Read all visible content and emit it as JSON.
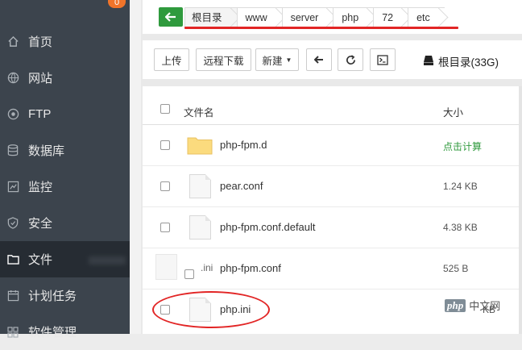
{
  "sidebar": {
    "badge": "0",
    "items": [
      {
        "label": "首页",
        "icon": "home-icon"
      },
      {
        "label": "网站",
        "icon": "globe-icon"
      },
      {
        "label": "FTP",
        "icon": "ftp-icon"
      },
      {
        "label": "数据库",
        "icon": "database-icon"
      },
      {
        "label": "监控",
        "icon": "monitor-icon"
      },
      {
        "label": "安全",
        "icon": "shield-icon"
      },
      {
        "label": "文件",
        "icon": "folder-icon"
      },
      {
        "label": "计划任务",
        "icon": "calendar-icon"
      },
      {
        "label": "软件管理",
        "icon": "apps-icon"
      }
    ],
    "active_index": 6
  },
  "breadcrumb": [
    "根目录",
    "www",
    "server",
    "php",
    "72",
    "etc"
  ],
  "toolbar": {
    "upload": "上传",
    "remote_download": "远程下载",
    "new": "新建",
    "disk_label": "根目录(33G)"
  },
  "table": {
    "headers": {
      "name": "文件名",
      "size": "大小"
    },
    "rows": [
      {
        "name": "php-fpm.d",
        "size": "点击计算",
        "type": "folder"
      },
      {
        "name": "pear.conf",
        "size": "1.24 KB",
        "type": "file"
      },
      {
        "name": "php-fpm.conf.default",
        "size": "4.38 KB",
        "type": "file"
      },
      {
        "name": "php-fpm.conf",
        "size": "525 B",
        "type": "file"
      },
      {
        "name": "php.ini",
        "size": "KB",
        "type": "file"
      }
    ],
    "ghost_text": ".ini"
  },
  "watermark": {
    "logo": "php",
    "text": "中文网"
  },
  "colors": {
    "sidebar_bg": "#3c444d",
    "sidebar_active": "#262c33",
    "accent_green": "#2f9a3d",
    "annotation_red": "#e22525",
    "badge_orange": "#f0742a"
  }
}
